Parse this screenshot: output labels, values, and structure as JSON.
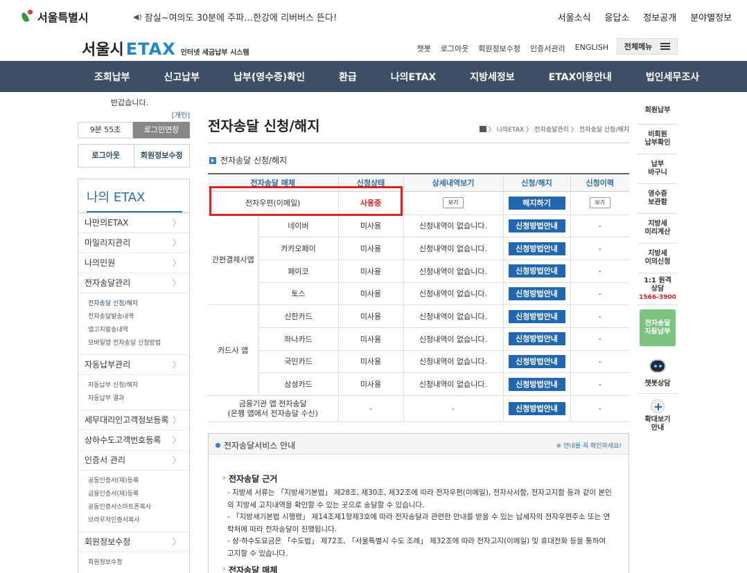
{
  "header": {
    "logo_text": "서울특별시",
    "notice": "잠실~여의도 30분에 주파…한강에 리버버스 뜬다!",
    "topnav": [
      "서울소식",
      "응답소",
      "정보공개",
      "분야별정보"
    ]
  },
  "brand": {
    "name": "서울시",
    "etax": "ETAX",
    "sub": "인터넷 세금납부 시스템",
    "utilnav": [
      "챗봇",
      "로그아웃",
      "회원정보수정",
      "인증서관리",
      "ENGLISH"
    ],
    "menu_all": "전체메뉴"
  },
  "gnb": [
    "조회납부",
    "신고납부",
    "납부(영수증)확인",
    "환급",
    "나의ETAX",
    "지방세정보",
    "ETAX이용안내",
    "법인세무조사"
  ],
  "left": {
    "greeting": "반갑습니다.",
    "user_type": "[개인]",
    "timer": "9분 55초",
    "extend": "로그인연장",
    "logout": "로그아웃",
    "member_edit": "회원정보수정",
    "section_title": "나의 ETAX",
    "menu": {
      "m1": "나만의ETAX",
      "m2": "마일리지관리",
      "m3": "나의민원",
      "m4": "전자송달관리",
      "m4_subs": [
        "전자송달 신청/해지",
        "전자송달발송내역",
        "앱고지발송내역",
        "모바일앱 전자송달 신청방법"
      ],
      "m5": "자동납부관리",
      "m5_subs": [
        "자동납부 신청/해지",
        "자동납부 결과"
      ],
      "m6": "세무대리인고객정보등록",
      "m7": "상하수도고객번호등록",
      "m8": "인증서 관리",
      "m8_subs": [
        "공동인증서(재)등록",
        "금융인증서(재)등록",
        "공동인증서스마트폰복사",
        "브라우저인증서복사"
      ],
      "m9": "회원정보수정",
      "m9_subs": [
        "회원정보수정"
      ]
    }
  },
  "main": {
    "title": "전자송달 신청/해지",
    "breadcrumb": [
      "나의ETAX",
      "전자송달관리",
      "전자송달 신청/해지"
    ],
    "section_title": "전자송달 신청/해지",
    "table": {
      "headers": [
        "전자송달 매체",
        "신청상태",
        "상세내역보기",
        "신청/해지",
        "신청이력"
      ],
      "row1": {
        "media": "전자우편(이메일)",
        "status": "사용중",
        "view": "보기",
        "action": "해지하기",
        "history": "보기"
      },
      "group1": "간편결제사앱",
      "group1_rows": [
        {
          "media": "네이버",
          "status": "미사용",
          "detail": "신청내역이 없습니다.",
          "action": "신청방법안내",
          "history": "-"
        },
        {
          "media": "카카오페이",
          "status": "미사용",
          "detail": "신청내역이 없습니다.",
          "action": "신청방법안내",
          "history": "-"
        },
        {
          "media": "페이코",
          "status": "미사용",
          "detail": "신청내역이 없습니다.",
          "action": "신청방법안내",
          "history": "-"
        },
        {
          "media": "토스",
          "status": "미사용",
          "detail": "신청내역이 없습니다.",
          "action": "신청방법안내",
          "history": "-"
        }
      ],
      "group2": "카드사 앱",
      "group2_rows": [
        {
          "media": "신한카드",
          "status": "미사용",
          "detail": "신청내역이 없습니다.",
          "action": "신청방법안내",
          "history": "-"
        },
        {
          "media": "하나카드",
          "status": "미사용",
          "detail": "신청내역이 없습니다.",
          "action": "신청방법안내",
          "history": "-"
        },
        {
          "media": "국민카드",
          "status": "미사용",
          "detail": "신청내역이 없습니다.",
          "action": "신청방법안내",
          "history": "-"
        },
        {
          "media": "삼성카드",
          "status": "미사용",
          "detail": "신청내역이 없습니다.",
          "action": "신청방법안내",
          "history": "-"
        }
      ],
      "last": {
        "media1": "금융기관 앱 전자송달",
        "media2": "(은행 앱에서 전자송달 수신)",
        "status": "-",
        "detail": "-",
        "action": "신청방법안내",
        "history": "-"
      }
    },
    "info": {
      "title": "전자송달서비스 안내",
      "note": "※ 안내를 꼭 확인하세요!",
      "h1": "전자송달 근거",
      "p1": "- 지방세 서류는 「지방세기본법」 제28조, 제30조, 제32조에 따라 전자우편(이메일), 전자사서함, 전자고지함 등과 같이 본인의 지방세 고지내역을 확인할 수 있는 곳으로 송달할 수 있습니다.",
      "p2": "- 「지방세기본법 시행령」 제14조제1항제3호에 따라 전자송달과 관련한 안내를 받을 수 있는 납세자의 전자우편주소 또는 연락처에 따라 전자송달이 진행됩니다.",
      "p3": "- 상·하수도요금은 「수도법」 제72조, 「서울특별시 수도 조례」 제32조에 따라 전자고지(이메일) 및 휴대전화 등을 통하여 고지할 수 있습니다.",
      "h2": "전자송달 매체"
    }
  },
  "quick": {
    "q1": "회원납부",
    "q2a": "비회원",
    "q2b": "납부확인",
    "q3a": "납부",
    "q3b": "바구니",
    "q4a": "영수증",
    "q4b": "보관함",
    "q5a": "지방세",
    "q5b": "미리계산",
    "q6a": "지방세",
    "q6b": "이의신청",
    "q7a": "1:1 원격",
    "q7b": "상담",
    "q7c": "1566-3900",
    "q8a": "전자송달",
    "q8b": "자동납부",
    "q9": "챗봇상담",
    "q10a": "확대보기",
    "q10b": "안내"
  }
}
